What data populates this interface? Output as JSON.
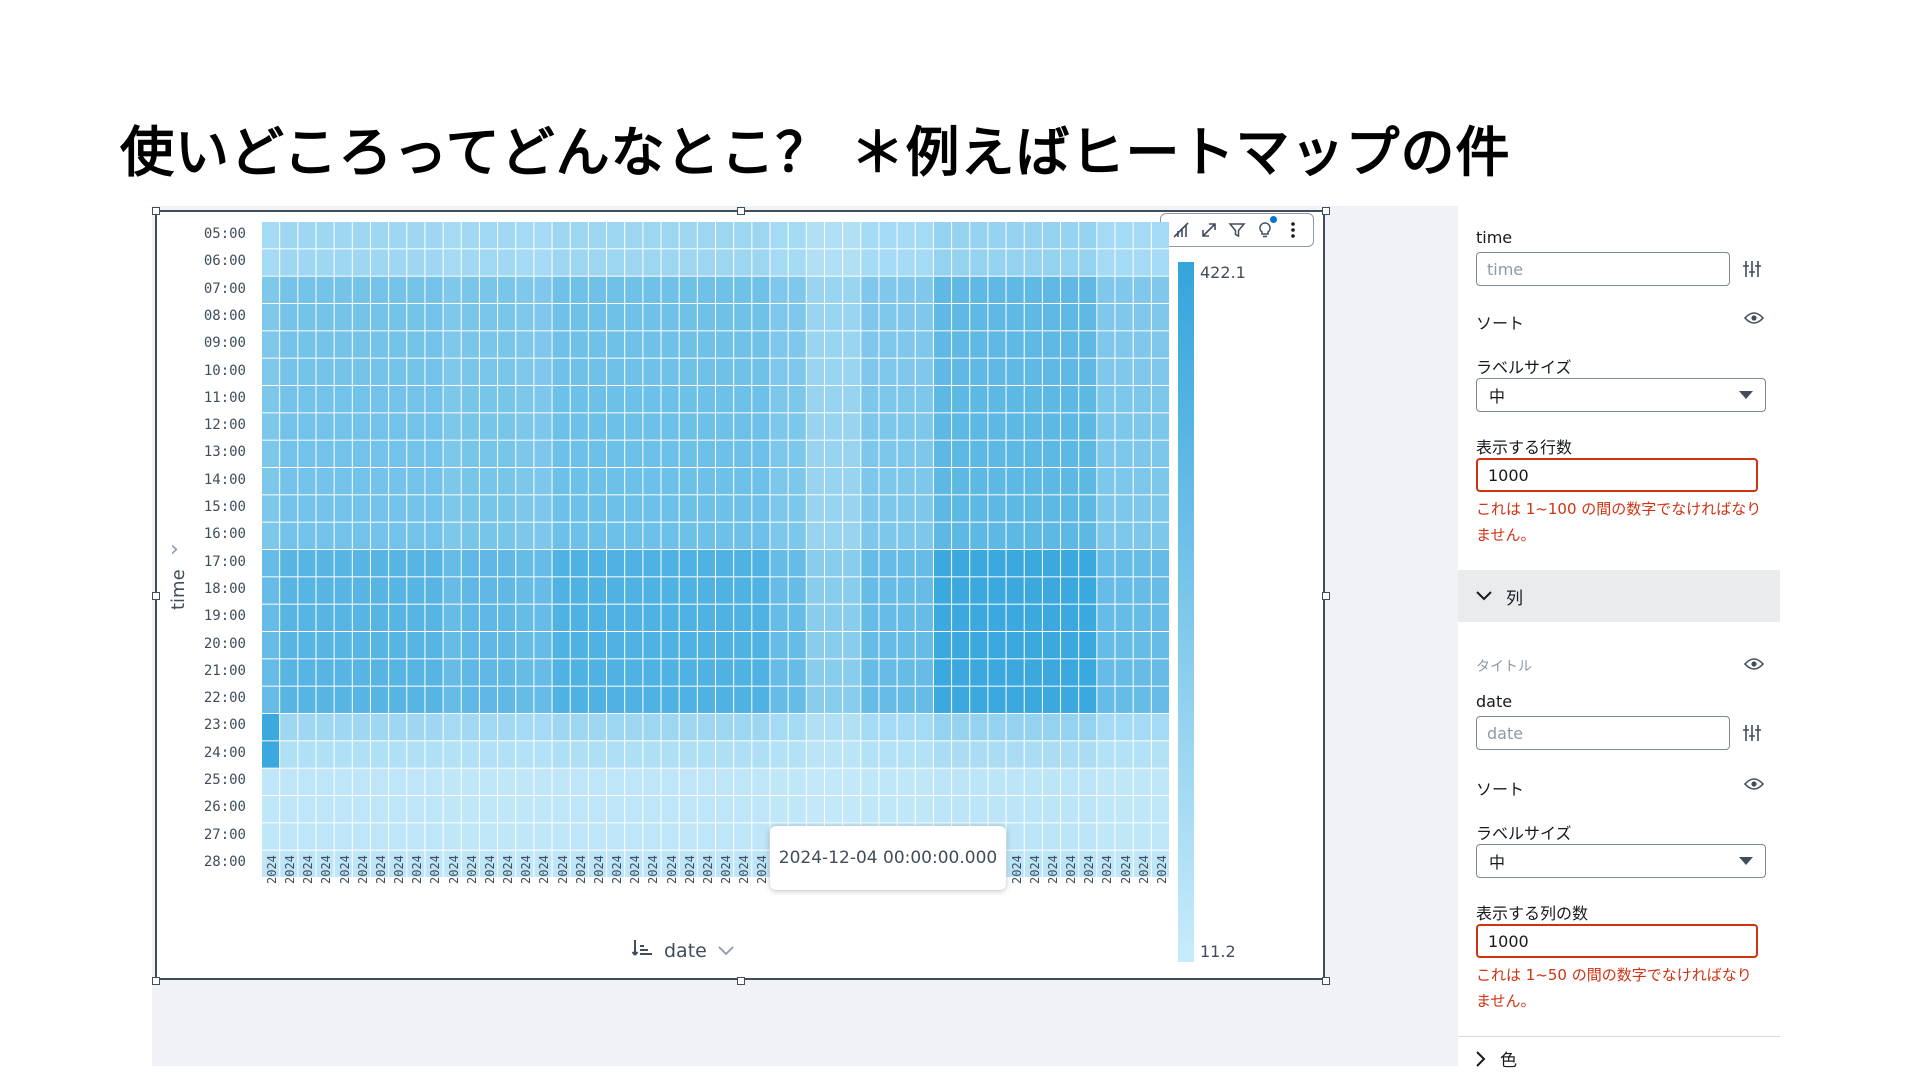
{
  "slide_title": "使いどころってどんなとこ？ ＊例えばヒートマップの件",
  "y_axis": {
    "title": "time",
    "labels": [
      "05:00",
      "06:00",
      "07:00",
      "08:00",
      "09:00",
      "10:00",
      "11:00",
      "12:00",
      "13:00",
      "14:00",
      "15:00",
      "16:00",
      "17:00",
      "18:00",
      "19:00",
      "20:00",
      "21:00",
      "22:00",
      "23:00",
      "24:00",
      "25:00",
      "26:00",
      "27:00",
      "28:00"
    ]
  },
  "x_axis": {
    "title": "date",
    "tick_label": "2024",
    "tick_count": 50
  },
  "tooltip": "2024-12-04 00:00:00.000",
  "legend": {
    "max": "422.1",
    "min": "11.2"
  },
  "chart_data": {
    "type": "heatmap",
    "x_label": "date",
    "y_label": "time",
    "rows": 24,
    "cols": 50,
    "value_range": [
      11.2,
      422.1
    ],
    "colors": {
      "low": "#c8ebfa",
      "high": "#34a4dc"
    }
  },
  "panel": {
    "rows_section": {
      "field_label": "time",
      "field_placeholder": "time",
      "sort_label": "ソート",
      "label_size_label": "ラベルサイズ",
      "label_size_value": "中",
      "count_label": "表示する行数",
      "count_value": "1000",
      "error": "これは 1~100 の間の数字でなければなりません。"
    },
    "columns_header": "列",
    "columns_section": {
      "title_label": "タイトル",
      "field_label": "date",
      "field_placeholder": "date",
      "sort_label": "ソート",
      "label_size_label": "ラベルサイズ",
      "label_size_value": "中",
      "count_label": "表示する列の数",
      "count_value": "1000",
      "error": "これは 1~50 の間の数字でなければなりません。"
    },
    "color_header": "色"
  }
}
